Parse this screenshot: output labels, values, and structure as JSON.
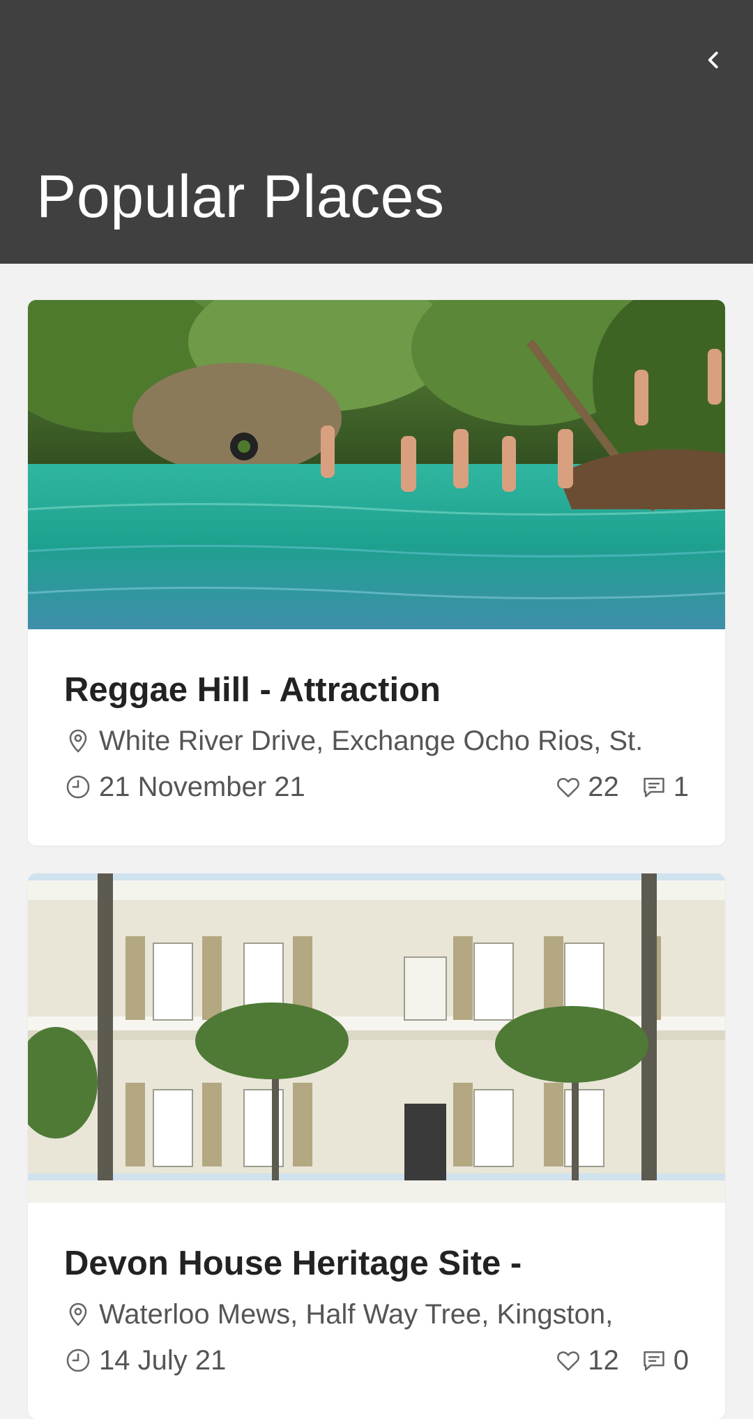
{
  "header": {
    "title": "Popular Places",
    "back_icon": "chevron-left-icon",
    "background": "#404040"
  },
  "places": [
    {
      "title": "Reggae Hill - Attraction",
      "location": "White River Drive, Exchange Ocho Rios, St.",
      "date": "21 November 21",
      "likes": "22",
      "comments": "1",
      "image": "river-swimmers-photo"
    },
    {
      "title": "Devon House Heritage Site -",
      "location": "Waterloo Mews, Half Way Tree, Kingston,",
      "date": "14 July 21",
      "likes": "12",
      "comments": "0",
      "image": "colonial-mansion-photo"
    }
  ],
  "icons": {
    "location": "map-pin-icon",
    "date": "clock-icon",
    "likes": "heart-icon",
    "comments": "comment-icon"
  }
}
